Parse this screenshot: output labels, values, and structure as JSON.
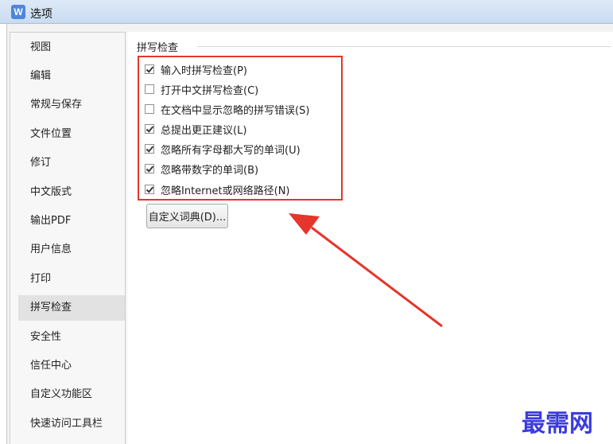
{
  "window": {
    "title": "选项",
    "app_icon_letter": "W"
  },
  "nav": {
    "items": [
      {
        "label": "视图"
      },
      {
        "label": "编辑"
      },
      {
        "label": "常规与保存"
      },
      {
        "label": "文件位置"
      },
      {
        "label": "修订"
      },
      {
        "label": "中文版式"
      },
      {
        "label": "输出PDF"
      },
      {
        "label": "用户信息"
      },
      {
        "label": "打印"
      },
      {
        "label": "拼写检查"
      },
      {
        "label": "安全性"
      },
      {
        "label": "信任中心"
      },
      {
        "label": "自定义功能区"
      },
      {
        "label": "快速访问工具栏"
      }
    ],
    "selected": "拼写检查"
  },
  "spelling": {
    "group_title": "拼写检查",
    "options": [
      {
        "label": "输入时拼写检查(P)",
        "checked": true
      },
      {
        "label": "打开中文拼写检查(C)",
        "checked": false
      },
      {
        "label": "在文档中显示忽略的拼写错误(S)",
        "checked": false
      },
      {
        "label": "总提出更正建议(L)",
        "checked": true
      },
      {
        "label": "忽略所有字母都大写的单词(U)",
        "checked": true
      },
      {
        "label": "忽略带数字的单词(B)",
        "checked": true
      },
      {
        "label": "忽略Internet或网络路径(N)",
        "checked": true
      }
    ],
    "custom_dict_button": "自定义词典(D)..."
  },
  "annotation": {
    "color": "#e5352c"
  },
  "watermark": {
    "text": "最需网"
  }
}
